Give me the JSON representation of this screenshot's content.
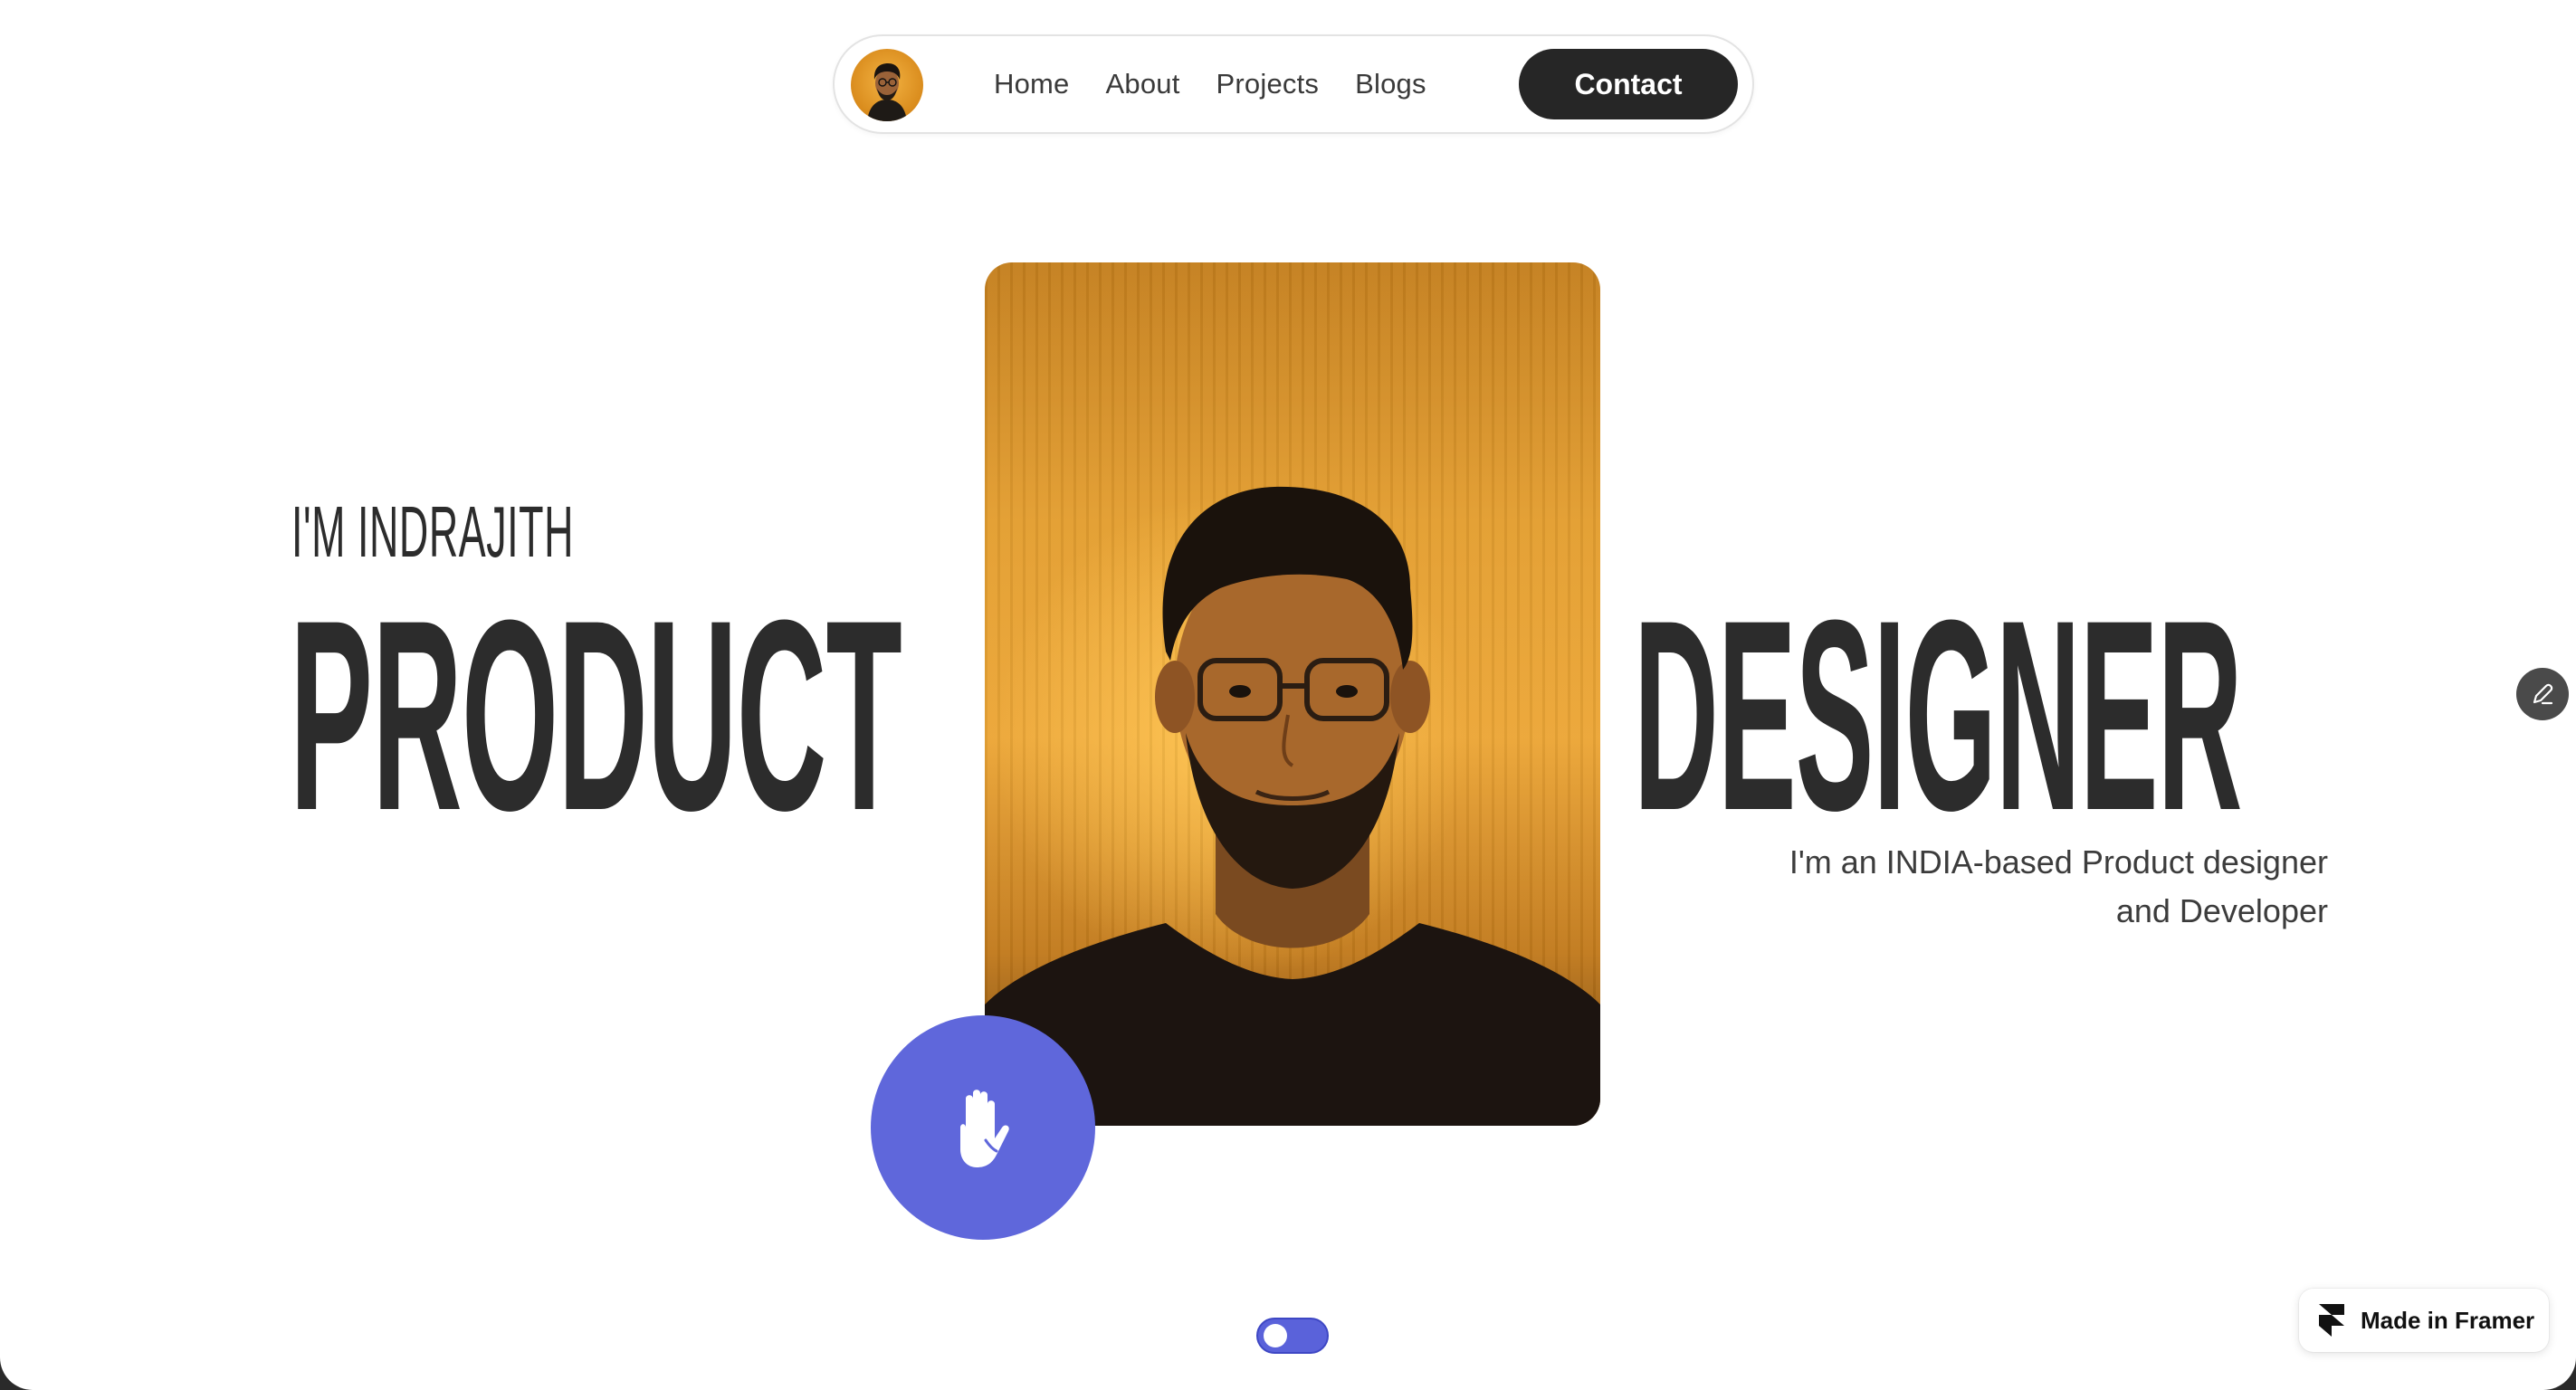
{
  "nav": {
    "links": [
      {
        "label": "Home"
      },
      {
        "label": "About"
      },
      {
        "label": "Projects"
      },
      {
        "label": "Blogs"
      }
    ],
    "contact_label": "Contact"
  },
  "hero": {
    "intro": "I'M INDRAJITH",
    "title_left": "PRODUCT",
    "title_right": "DESIGNER",
    "tagline_line1": "I'm an INDIA-based Product designer",
    "tagline_line2": "and Developer"
  },
  "badges": {
    "framer": "Made in Framer"
  },
  "colors": {
    "accent": "#5f67db",
    "dark": "#262626",
    "text": "#2c2c2c"
  },
  "icons": {
    "hand": "hand-wave-icon",
    "edit": "pencil-icon",
    "framer": "framer-logo-icon"
  }
}
